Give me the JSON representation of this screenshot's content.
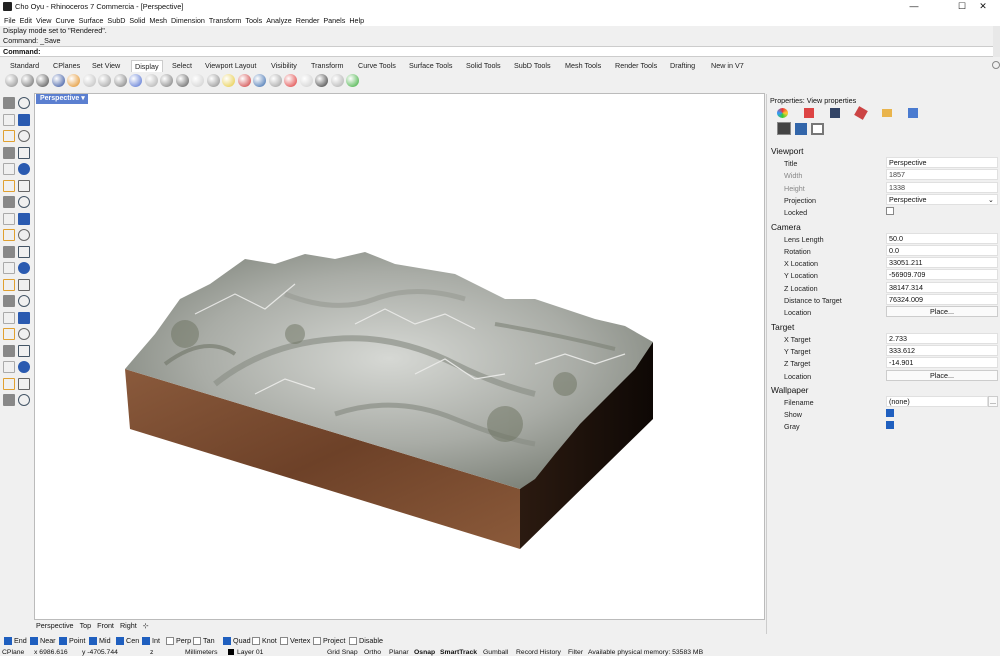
{
  "window": {
    "title": "Cho Oyu - Rhinoceros 7 Commercia - [Perspective]",
    "minimize": "—",
    "maximize": "☐",
    "close": "✕"
  },
  "menu": [
    "File",
    "Edit",
    "View",
    "Curve",
    "Surface",
    "SubD",
    "Solid",
    "Mesh",
    "Dimension",
    "Transform",
    "Tools",
    "Analyze",
    "Render",
    "Panels",
    "Help"
  ],
  "command": {
    "history1": "Display mode set to \"Rendered\".",
    "history2": "Command: _Save",
    "prompt": "Command:"
  },
  "tabs": [
    "Standard",
    "CPlanes",
    "Set View",
    "Display",
    "Select",
    "Viewport Layout",
    "Visibility",
    "Transform",
    "Curve Tools",
    "Surface Tools",
    "Solid Tools",
    "SubD Tools",
    "Mesh Tools",
    "Render Tools",
    "Drafting",
    "New in V7"
  ],
  "active_tab": "Display",
  "viewport": {
    "title": "Perspective"
  },
  "viewport_tabs": [
    "Perspective",
    "Top",
    "Front",
    "Right"
  ],
  "osnap": [
    {
      "label": "End",
      "on": true
    },
    {
      "label": "Near",
      "on": true
    },
    {
      "label": "Point",
      "on": true
    },
    {
      "label": "Mid",
      "on": true
    },
    {
      "label": "Cen",
      "on": true
    },
    {
      "label": "Int",
      "on": true
    },
    {
      "label": "Perp",
      "on": false
    },
    {
      "label": "Tan",
      "on": false
    },
    {
      "label": "Quad",
      "on": true
    },
    {
      "label": "Knot",
      "on": false
    },
    {
      "label": "Vertex",
      "on": false
    },
    {
      "label": "Project",
      "on": false
    },
    {
      "label": "Disable",
      "on": false
    }
  ],
  "status": {
    "cplane": "CPlane",
    "x": "x 6986.616",
    "y": "y -4705.744",
    "z": "z",
    "units": "Millimeters",
    "layer": "Layer 01",
    "grid": "Grid Snap",
    "ortho": "Ortho",
    "planar": "Planar",
    "osnap": "Osnap",
    "smarttrack": "SmartTrack",
    "gumball": "Gumball",
    "history": "Record History",
    "filter": "Filter",
    "memory": "Available physical memory: 53583 MB"
  },
  "properties": {
    "header": "Properties: View properties",
    "viewport_section": "Viewport",
    "title_label": "Title",
    "title_value": "Perspective",
    "width_label": "Width",
    "width_value": "1857",
    "height_label": "Height",
    "height_value": "1338",
    "projection_label": "Projection",
    "projection_value": "Perspective",
    "locked_label": "Locked",
    "locked": false,
    "camera_section": "Camera",
    "lens_label": "Lens Length",
    "lens_value": "50.0",
    "rotation_label": "Rotation",
    "rotation_value": "0.0",
    "xloc_label": "X Location",
    "xloc_value": "33051.211",
    "yloc_label": "Y Location",
    "yloc_value": "-56909.709",
    "zloc_label": "Z Location",
    "zloc_value": "38147.314",
    "dist_label": "Distance to Target",
    "dist_value": "76324.009",
    "loc_label": "Location",
    "place_button": "Place...",
    "target_section": "Target",
    "xt_label": "X Target",
    "xt_value": "2.733",
    "yt_label": "Y Target",
    "yt_value": "333.612",
    "zt_label": "Z Target",
    "zt_value": "-14.901",
    "tloc_label": "Location",
    "tplace_button": "Place...",
    "wallpaper_section": "Wallpaper",
    "filename_label": "Filename",
    "filename_value": "(none)",
    "browse_button": "...",
    "show_label": "Show",
    "show": true,
    "gray_label": "Gray",
    "gray": true
  },
  "colors": {
    "accent": "#1f5fbf",
    "viewport_tab": "#5b7fd0",
    "rock": "#b9bcb8",
    "earth": "#7a4a30"
  }
}
